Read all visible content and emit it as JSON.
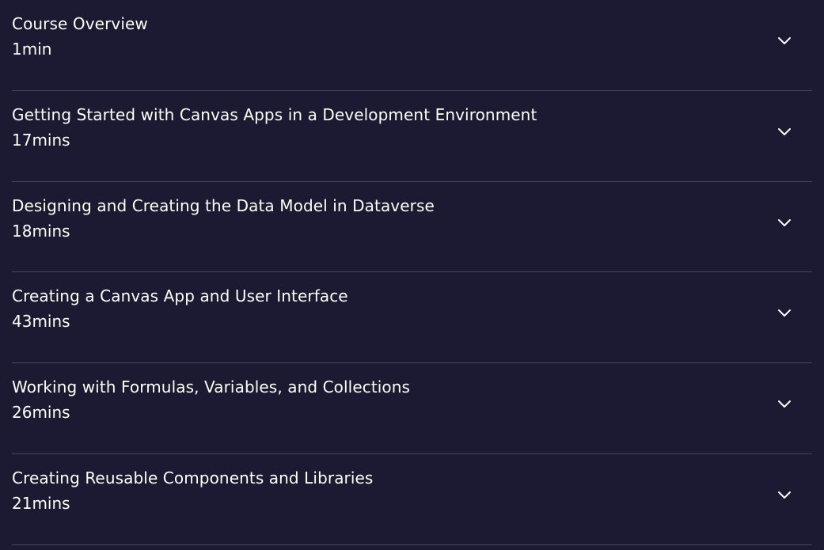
{
  "colors": {
    "background": "#1c1a33",
    "divider": "#45435e",
    "text": "#ffffff"
  },
  "modules": [
    {
      "title": "Course Overview",
      "duration": "1min",
      "icon": "chevron-down-icon"
    },
    {
      "title": "Getting Started with Canvas Apps in a Development Environment",
      "duration": "17mins",
      "icon": "chevron-down-icon"
    },
    {
      "title": "Designing and Creating the Data Model in Dataverse",
      "duration": "18mins",
      "icon": "chevron-down-icon"
    },
    {
      "title": "Creating a Canvas App and User Interface",
      "duration": "43mins",
      "icon": "chevron-down-icon"
    },
    {
      "title": "Working with Formulas, Variables, and Collections",
      "duration": "26mins",
      "icon": "chevron-down-icon"
    },
    {
      "title": "Creating Reusable Components and Libraries",
      "duration": "21mins",
      "icon": "chevron-down-icon"
    }
  ]
}
